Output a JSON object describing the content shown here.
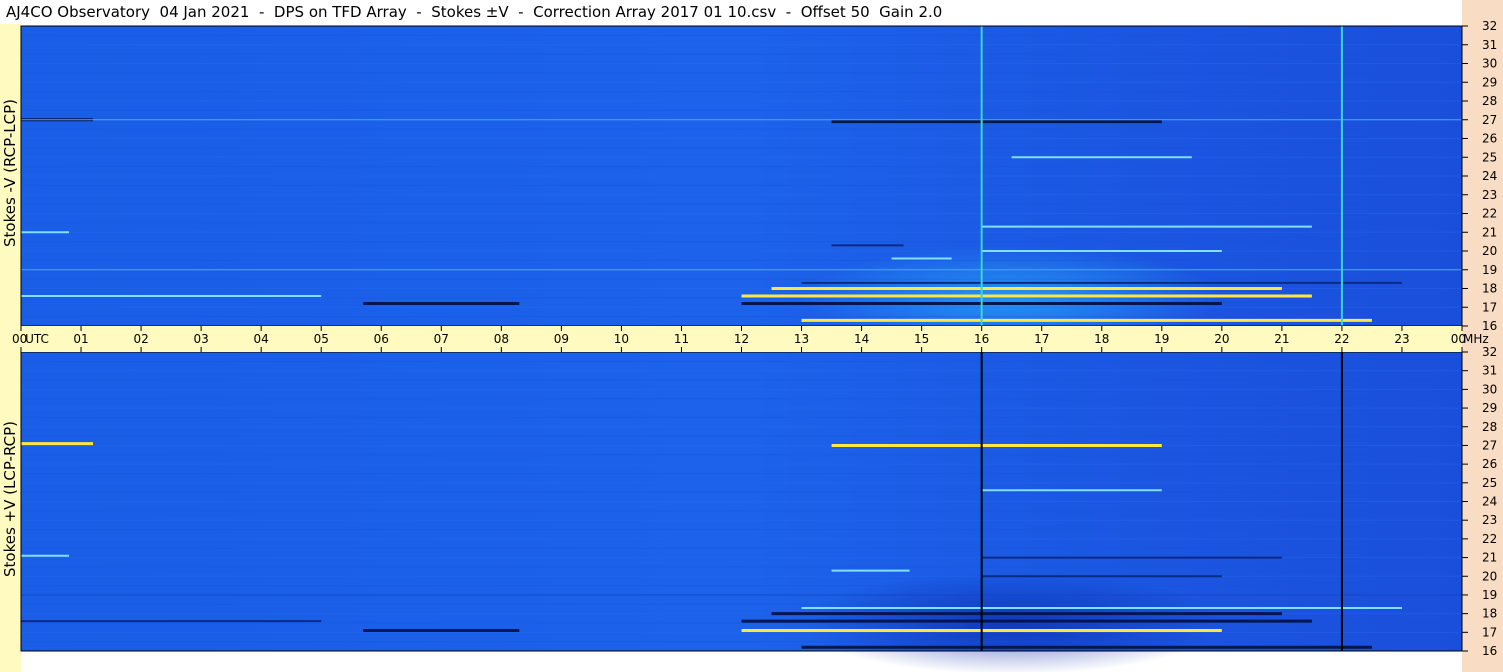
{
  "title": "AJ4CO Observatory  04 Jan 2021  -  DPS on TFD Array  -  Stokes ±V  -  Correction Array 2017 01 10.csv  -  Offset 50  Gain 2.0",
  "chart_data": [
    {
      "type": "heatmap",
      "name": "top-panel",
      "ylabel": "Stokes -V (RCP-LCP)",
      "x_axis_label": "UTC",
      "y_unit": "MHz",
      "x_ticks": [
        "00",
        "01",
        "02",
        "03",
        "04",
        "05",
        "06",
        "07",
        "08",
        "09",
        "10",
        "11",
        "12",
        "13",
        "14",
        "15",
        "16",
        "17",
        "18",
        "19",
        "20",
        "21",
        "22",
        "23",
        "00"
      ],
      "y_ticks": [
        "32",
        "31",
        "30",
        "29",
        "28",
        "27",
        "26",
        "25",
        "24",
        "23",
        "22",
        "21",
        "20",
        "19",
        "18",
        "17",
        "16"
      ],
      "xlim_hours": [
        0,
        24
      ],
      "ylim_mhz": [
        16,
        32
      ],
      "vertical_markers_hours": [
        16,
        22
      ],
      "marker_color": "#3ad6d0",
      "background_color": "#1c5fe8",
      "bands": [
        {
          "freq": 27.0,
          "start": 0.0,
          "end": 1.2,
          "intensity": "strong-dark"
        },
        {
          "freq": 26.9,
          "start": 13.5,
          "end": 19.0,
          "intensity": "strong-dark"
        },
        {
          "freq": 27.0,
          "start": 0.0,
          "end": 24.0,
          "intensity": "faint-light"
        },
        {
          "freq": 25.0,
          "start": 16.5,
          "end": 19.5,
          "intensity": "light"
        },
        {
          "freq": 21.3,
          "start": 16.0,
          "end": 21.5,
          "intensity": "light"
        },
        {
          "freq": 21.0,
          "start": 0.0,
          "end": 0.8,
          "intensity": "light"
        },
        {
          "freq": 20.3,
          "start": 13.5,
          "end": 14.7,
          "intensity": "dark"
        },
        {
          "freq": 20.0,
          "start": 16.0,
          "end": 20.0,
          "intensity": "light"
        },
        {
          "freq": 19.6,
          "start": 14.5,
          "end": 15.5,
          "intensity": "light"
        },
        {
          "freq": 19.0,
          "start": 0.0,
          "end": 24.0,
          "intensity": "faint-light"
        },
        {
          "freq": 18.3,
          "start": 13.0,
          "end": 23.0,
          "intensity": "dark"
        },
        {
          "freq": 18.0,
          "start": 12.5,
          "end": 21.0,
          "intensity": "strong-light"
        },
        {
          "freq": 17.6,
          "start": 0.0,
          "end": 5.0,
          "intensity": "light"
        },
        {
          "freq": 17.6,
          "start": 12.0,
          "end": 21.5,
          "intensity": "strong-light"
        },
        {
          "freq": 17.2,
          "start": 5.7,
          "end": 8.3,
          "intensity": "strong-dark"
        },
        {
          "freq": 17.2,
          "start": 12.0,
          "end": 20.0,
          "intensity": "strong-dark"
        },
        {
          "freq": 16.3,
          "start": 13.0,
          "end": 22.5,
          "intensity": "strong-light"
        }
      ]
    },
    {
      "type": "heatmap",
      "name": "bottom-panel",
      "ylabel": "Stokes +V (LCP-RCP)",
      "y_unit": "MHz",
      "y_ticks": [
        "32",
        "31",
        "30",
        "29",
        "28",
        "27",
        "26",
        "25",
        "24",
        "23",
        "22",
        "21",
        "20",
        "19",
        "18",
        "17",
        "16"
      ],
      "xlim_hours": [
        0,
        24
      ],
      "ylim_mhz": [
        16,
        32
      ],
      "vertical_markers_hours": [
        16,
        22
      ],
      "marker_color": "#000000",
      "background_color": "#1c5fe8",
      "bands": [
        {
          "freq": 27.1,
          "start": 0.0,
          "end": 1.2,
          "intensity": "strong-light"
        },
        {
          "freq": 27.0,
          "start": 13.5,
          "end": 19.0,
          "intensity": "strong-light"
        },
        {
          "freq": 24.6,
          "start": 16.0,
          "end": 19.0,
          "intensity": "light"
        },
        {
          "freq": 21.1,
          "start": 0.0,
          "end": 0.8,
          "intensity": "light"
        },
        {
          "freq": 21.0,
          "start": 16.0,
          "end": 21.0,
          "intensity": "dark"
        },
        {
          "freq": 20.3,
          "start": 13.5,
          "end": 14.8,
          "intensity": "light"
        },
        {
          "freq": 20.0,
          "start": 16.0,
          "end": 20.0,
          "intensity": "dark"
        },
        {
          "freq": 19.0,
          "start": 0.0,
          "end": 24.0,
          "intensity": "faint-dark"
        },
        {
          "freq": 18.3,
          "start": 13.0,
          "end": 23.0,
          "intensity": "light"
        },
        {
          "freq": 18.0,
          "start": 12.5,
          "end": 21.0,
          "intensity": "strong-dark"
        },
        {
          "freq": 17.6,
          "start": 0.0,
          "end": 5.0,
          "intensity": "dark"
        },
        {
          "freq": 17.6,
          "start": 12.0,
          "end": 21.5,
          "intensity": "strong-dark"
        },
        {
          "freq": 17.1,
          "start": 5.7,
          "end": 8.3,
          "intensity": "strong-dark"
        },
        {
          "freq": 17.1,
          "start": 12.0,
          "end": 20.0,
          "intensity": "strong-light"
        },
        {
          "freq": 16.2,
          "start": 13.0,
          "end": 22.5,
          "intensity": "strong-dark"
        }
      ]
    }
  ]
}
